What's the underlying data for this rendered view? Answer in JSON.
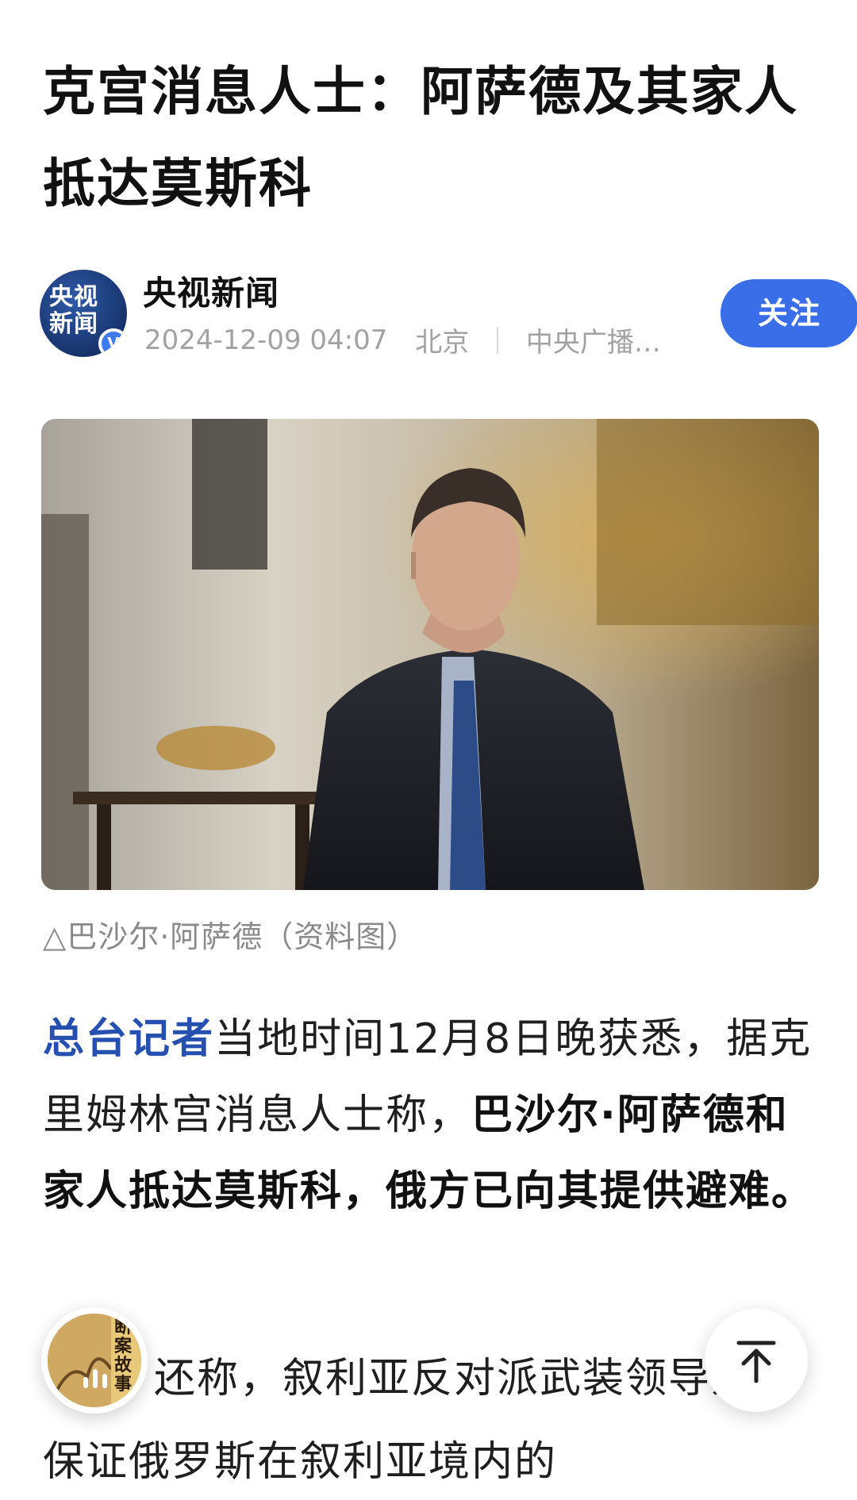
{
  "article": {
    "title": "克宫消息人士：阿萨德及其家人抵达莫斯科",
    "author": {
      "name": "央视新闻",
      "avatar_text": "央视新闻",
      "verified_mark": "V",
      "date": "2024-12-09 04:07",
      "location": "北京",
      "source": "中央广播…"
    },
    "follow_label": "关注",
    "image_caption": "△巴沙尔·阿萨德（资料图）",
    "body": {
      "lead_highlight": "总台记者",
      "lead_text": "当地时间12月8日晚获悉，据克里姆林宫消息人士称，",
      "lead_bold": "巴沙尔·阿萨德和家人抵达莫斯科，俄方已向其提供避难。",
      "p2_line1": "还称，叙利亚反对派武装领导人",
      "p2_line2": "保证俄罗斯在叙利亚境内的"
    }
  },
  "floating": {
    "audio_cover_text": "断案故事",
    "colors": {
      "accent": "#3a6ee8",
      "highlight": "#2650b0",
      "meta": "#a2a2a2"
    }
  }
}
